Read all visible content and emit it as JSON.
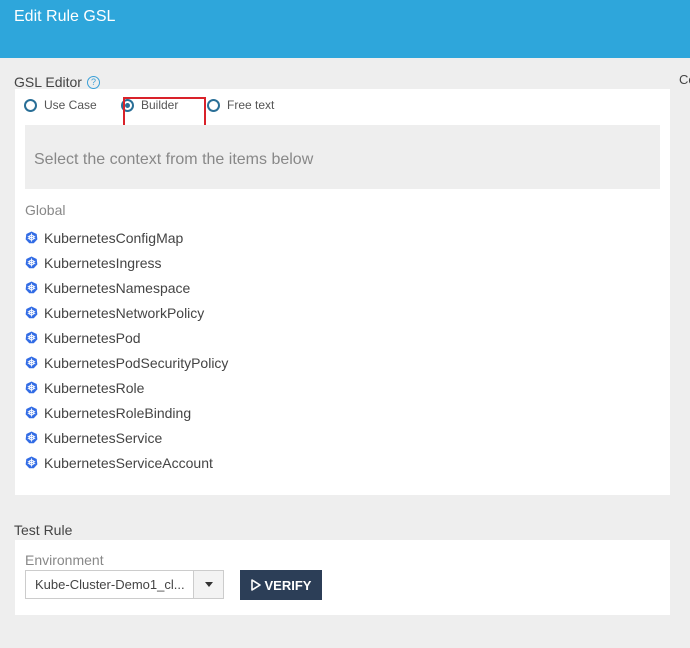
{
  "header": {
    "title": "Edit Rule GSL"
  },
  "gsl_editor": {
    "label": "GSL Editor",
    "help_icon": "question-circle-icon",
    "right_clip_text": "Co",
    "modes": [
      {
        "label": "Use Case",
        "selected": false
      },
      {
        "label": "Builder",
        "selected": true
      },
      {
        "label": "Free text",
        "selected": false
      }
    ],
    "prompt": "Select the context from the items below",
    "group_heading": "Global",
    "item_icon": "kubernetes-helm-icon",
    "items": [
      "KubernetesConfigMap",
      "KubernetesIngress",
      "KubernetesNamespace",
      "KubernetesNetworkPolicy",
      "KubernetesPod",
      "KubernetesPodSecurityPolicy",
      "KubernetesRole",
      "KubernetesRoleBinding",
      "KubernetesService",
      "KubernetesServiceAccount"
    ]
  },
  "test_rule": {
    "label": "Test Rule",
    "environment_label": "Environment",
    "environment_value": "Kube-Cluster-Demo1_cl...",
    "verify_label": "VERIFY"
  },
  "colors": {
    "header": "#2ea6db",
    "verify_button": "#2c3e57",
    "highlight": "#d9222a",
    "icon": "#326ce5"
  }
}
